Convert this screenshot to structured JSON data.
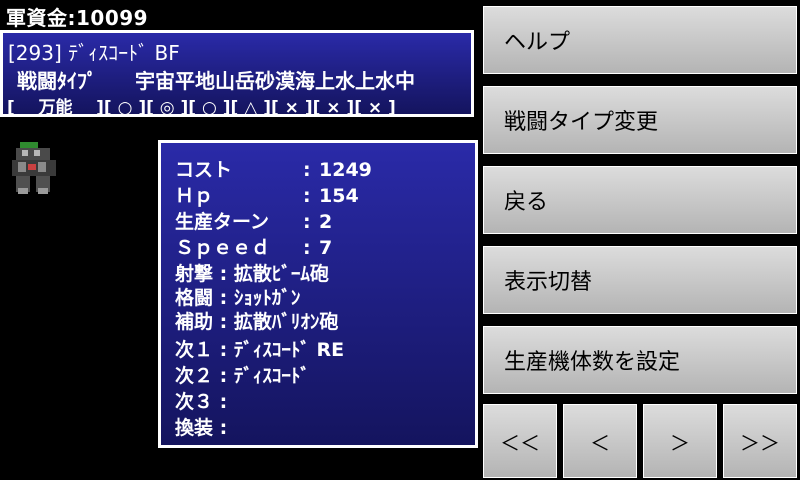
{
  "funds": "軍資金:10099",
  "unit": {
    "name": "[293] ﾃﾞｨｽｺｰﾄﾞ BF",
    "terrain_label": "戦闘ﾀｲﾌﾟ",
    "terrains": "宇宙平地山岳砂漠海上水上水中",
    "ratings": "[    万能    ][ ○ ][ ◎ ][ ○ ][ △ ][ × ][ × ][ × ]"
  },
  "stats": [
    {
      "label": "コスト",
      "value": "1249"
    },
    {
      "label": "Ｈｐ",
      "value": "154"
    },
    {
      "label": "生産ターン",
      "value": "2"
    },
    {
      "label": "Ｓｐｅｅｄ",
      "value": "7"
    }
  ],
  "weapons": [
    {
      "label": "射撃",
      "value": "拡散ﾋﾞｰﾑ砲"
    },
    {
      "label": "格闘",
      "value": "ｼｮｯﾄｶﾞﾝ"
    },
    {
      "label": "補助",
      "value": "拡散ﾊﾞﾘｵﾝ砲"
    },
    {
      "label": "次１",
      "value": "ﾃﾞｨｽｺｰﾄﾞ RE"
    },
    {
      "label": "次２",
      "value": "ﾃﾞｨｽｺｰﾄﾞ"
    },
    {
      "label": "次３",
      "value": ""
    },
    {
      "label": "換装",
      "value": ""
    }
  ],
  "buttons": {
    "help": "ヘルプ",
    "change_type": "戦闘タイプ変更",
    "back": "戻る",
    "toggle_view": "表示切替",
    "set_count": "生産機体数を設定"
  },
  "nav": {
    "first": "＜＜",
    "prev": "＜",
    "next": "＞",
    "last": "＞＞"
  }
}
